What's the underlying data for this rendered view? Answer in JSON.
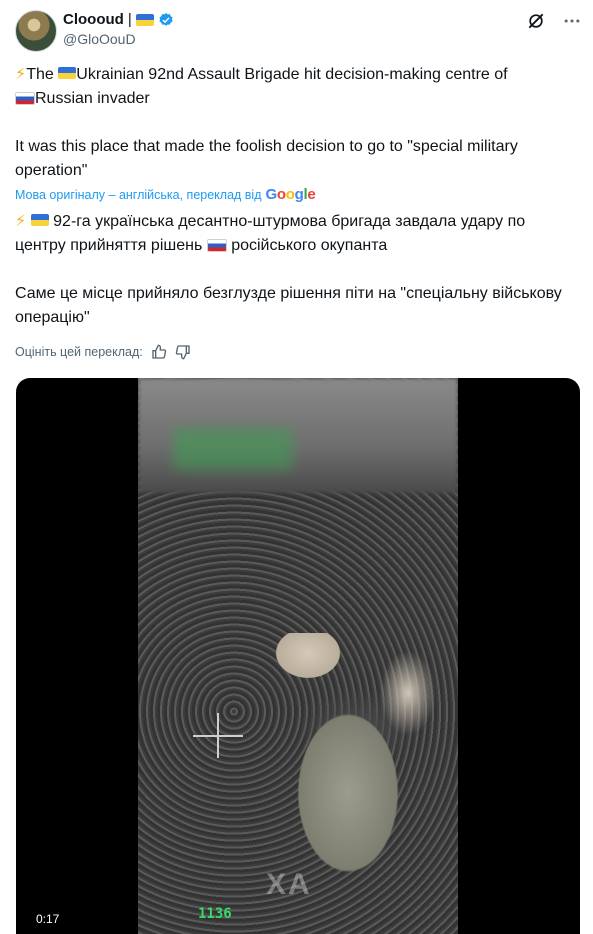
{
  "author": {
    "name": "Cloooud",
    "name_separator": "|",
    "handle": "@GloOouD"
  },
  "tweet": {
    "line1_a": "The",
    "line1_b": "Ukrainian 92nd Assault Brigade hit decision-making centre of",
    "line1_c": "Russian invader",
    "line2": "It was this place that made the foolish decision to go to \"special military operation\""
  },
  "translation": {
    "note": "Мова оригіналу – англійська, переклад від",
    "provider": "Google",
    "line1_a": "92-га українська десантно-штурмова бригада завдала удару по центру прийняття рішень",
    "line1_b": "російського окупанта",
    "line2": "Саме це місце прийняло безглузде рішення піти на \"спеціальну військову операцію\"",
    "rate_label": "Оцініть цей переклад:"
  },
  "video": {
    "time": "0:17",
    "overlay_counter": "1136",
    "watermark": "XA"
  },
  "icons": {
    "grok": "grok-icon",
    "more": "more-icon",
    "verified": "verified-badge-icon",
    "thumbs_up": "thumbs-up-icon",
    "thumbs_down": "thumbs-down-icon",
    "lightning": "lightning-icon",
    "flag_ua": "ukraine-flag-icon",
    "flag_ru": "russia-flag-icon"
  },
  "colors": {
    "link": "#1d9bf0",
    "secondary_text": "#536471",
    "verified": "#1d9bf0"
  }
}
